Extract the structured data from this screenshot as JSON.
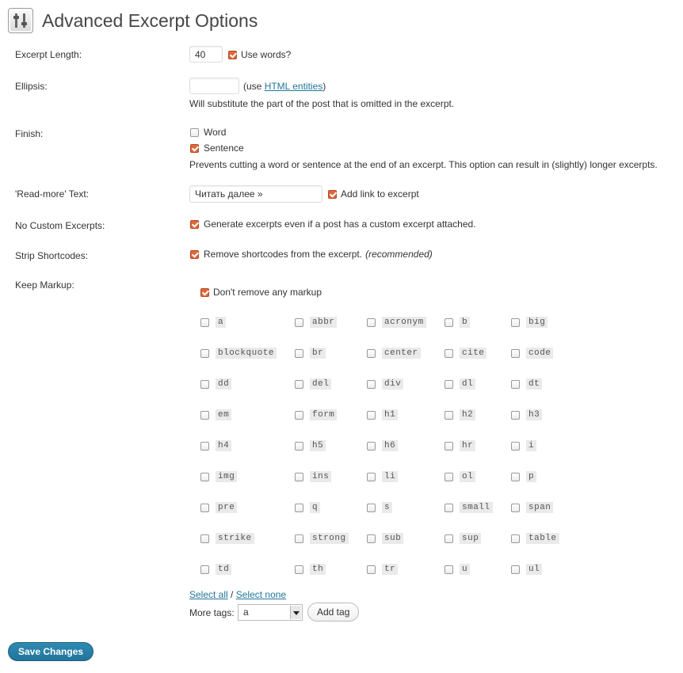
{
  "page": {
    "title": "Advanced Excerpt Options"
  },
  "excerpt_length": {
    "label": "Excerpt Length:",
    "value": "40",
    "use_words_label": "Use words?",
    "use_words_checked": true
  },
  "ellipsis": {
    "label": "Ellipsis:",
    "value": "",
    "hint_prefix": "(use ",
    "hint_link": "HTML entities",
    "hint_suffix": ")",
    "description": "Will substitute the part of the post that is omitted in the excerpt."
  },
  "finish": {
    "label": "Finish:",
    "word_label": "Word",
    "word_checked": false,
    "sentence_label": "Sentence",
    "sentence_checked": true,
    "description": "Prevents cutting a word or sentence at the end of an excerpt. This option can result in (slightly) longer excerpts."
  },
  "read_more": {
    "label": "'Read-more' Text:",
    "value": "Читать далее »",
    "add_link_label": "Add link to excerpt",
    "add_link_checked": true
  },
  "no_custom": {
    "label": "No Custom Excerpts:",
    "option_label": "Generate excerpts even if a post has a custom excerpt attached.",
    "checked": true
  },
  "strip_shortcodes": {
    "label": "Strip Shortcodes:",
    "option_label": "Remove shortcodes from the excerpt.",
    "recommended": "(recommended)",
    "checked": true
  },
  "keep_markup": {
    "label": "Keep Markup:",
    "dont_remove_label": "Don't remove any markup",
    "dont_remove_checked": true,
    "tags": [
      "a",
      "abbr",
      "acronym",
      "b",
      "big",
      "blockquote",
      "br",
      "center",
      "cite",
      "code",
      "dd",
      "del",
      "div",
      "dl",
      "dt",
      "em",
      "form",
      "h1",
      "h2",
      "h3",
      "h4",
      "h5",
      "h6",
      "hr",
      "i",
      "img",
      "ins",
      "li",
      "ol",
      "p",
      "pre",
      "q",
      "s",
      "small",
      "span",
      "strike",
      "strong",
      "sub",
      "sup",
      "table",
      "td",
      "th",
      "tr",
      "u",
      "ul"
    ],
    "select_all": "Select all",
    "separator": " / ",
    "select_none": "Select none",
    "more_tags_label": "More tags:",
    "more_tags_value": "a",
    "add_tag_button": "Add tag"
  },
  "save_button": "Save Changes",
  "colors": {
    "accent_checkbox": "#e1663a",
    "link": "#21759b",
    "primary_button": "#21759b"
  }
}
